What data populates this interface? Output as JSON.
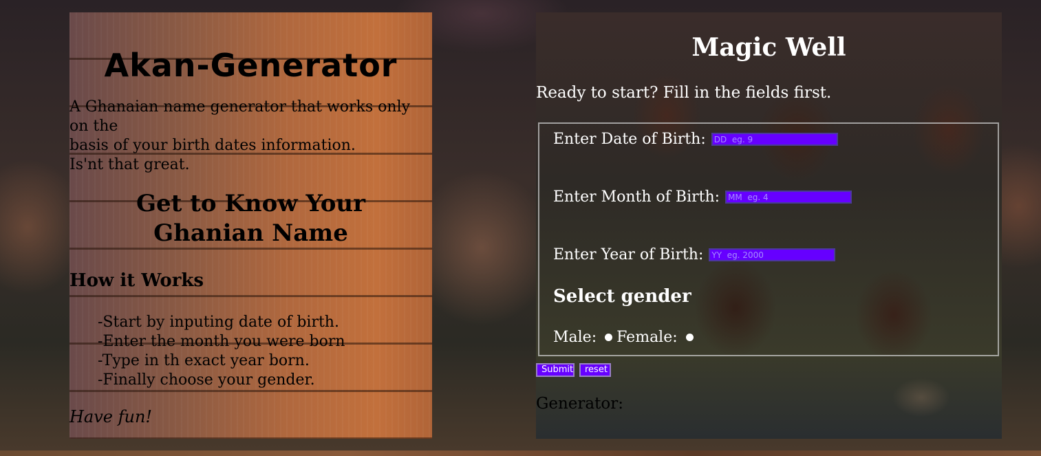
{
  "left": {
    "app_title": "Akan-Generator",
    "intro_lines": [
      "A Ghanaian name generator that works only on the",
      "basis of your birth dates information.",
      "Is'nt that great."
    ],
    "subtitle": "Get to Know Your Ghanian Name",
    "how_title": "How it Works",
    "steps": [
      "-Start by inputing date of birth.",
      "-Enter the month you were born",
      "-Type in th exact year born.",
      "-Finally choose your gender."
    ],
    "closing": "Have fun!"
  },
  "right": {
    "title": "Magic Well",
    "ready_text": "Ready to start? Fill in the fields first.",
    "fields": {
      "day": {
        "label": "Enter Date of Birth:",
        "placeholder": "DD  eg. 9",
        "value": ""
      },
      "month": {
        "label": "Enter Month of Birth:",
        "placeholder": "MM  eg. 4",
        "value": ""
      },
      "year": {
        "label": "Enter Year of Birth:",
        "placeholder": "YY  eg. 2000",
        "value": ""
      }
    },
    "gender_title": "Select gender",
    "gender_options": {
      "male": "Male:",
      "female": "Female:"
    },
    "submit_label": "Submit",
    "reset_label": "reset",
    "generator_label": "Generator:"
  },
  "colors": {
    "input_bg": "#6600ff",
    "button_bg": "#6600ff",
    "text_dark": "#000000",
    "text_light": "#ffffff"
  }
}
